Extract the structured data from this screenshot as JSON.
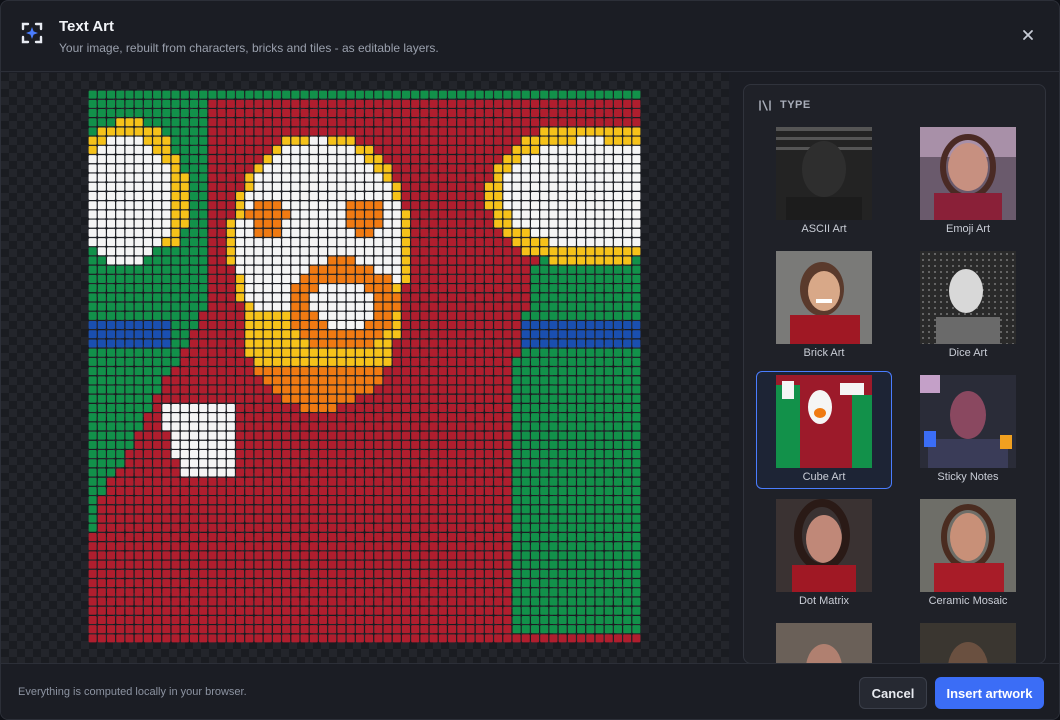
{
  "header": {
    "title": "Text Art",
    "subtitle": "Your image, rebuilt from characters, bricks and tiles - as editable layers.",
    "app_icon": "sparkle-frame-icon",
    "close_icon": "close-icon"
  },
  "panel": {
    "heading": "TYPE",
    "heading_icon": "type-filter-icon",
    "styles": [
      {
        "label": "ASCII Art",
        "selected": false
      },
      {
        "label": "Emoji Art",
        "selected": false
      },
      {
        "label": "Brick Art",
        "selected": false
      },
      {
        "label": "Dice Art",
        "selected": false
      },
      {
        "label": "Cube Art",
        "selected": true
      },
      {
        "label": "Sticky Notes",
        "selected": false
      },
      {
        "label": "Dot Matrix",
        "selected": false
      },
      {
        "label": "Ceramic Mosaic",
        "selected": false
      },
      {
        "label": "",
        "selected": false
      },
      {
        "label": "",
        "selected": false
      }
    ]
  },
  "footer": {
    "note": "Everything is computed locally in your browser.",
    "cancel_label": "Cancel",
    "insert_label": "Insert artwork"
  },
  "colors": {
    "accent": "#3b6df6",
    "cube_red": "#b01e2e",
    "cube_green": "#12914a",
    "cube_white": "#f5f5f5",
    "cube_orange": "#f07a12",
    "cube_yellow": "#f6c21a",
    "cube_blue": "#1a4fb0"
  }
}
